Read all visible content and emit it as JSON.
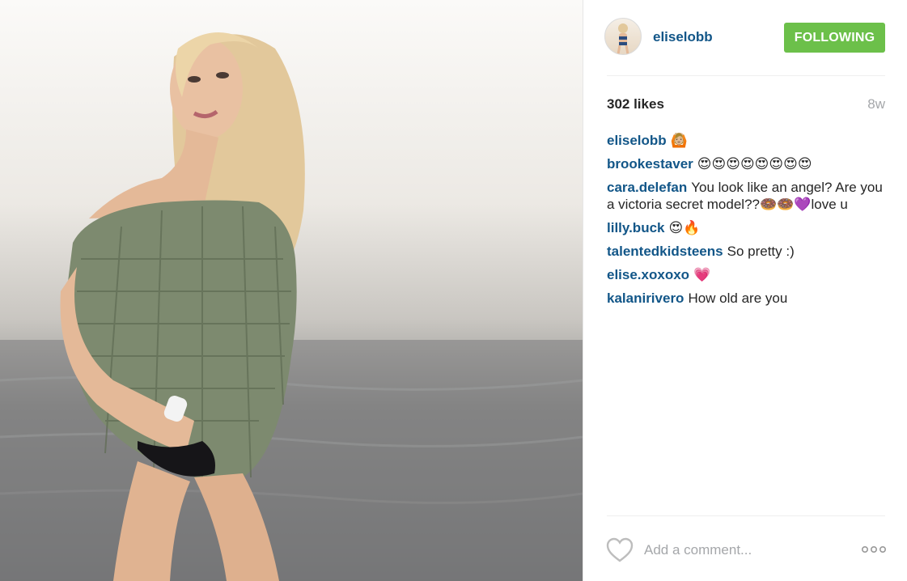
{
  "post": {
    "username": "eliselobb",
    "follow_label": "FOLLOWING",
    "likes": "302 likes",
    "time": "8w"
  },
  "comments": [
    {
      "user": "eliselobb",
      "text": "🙆🏼"
    },
    {
      "user": "brookestaver",
      "text": "😍😍😍😍😍😍😍😍"
    },
    {
      "user": "cara.delefan",
      "text": "You look like an angel? Are you a victoria secret model??🍩🍩💜love u"
    },
    {
      "user": "lilly.buck",
      "text": "😍🔥"
    },
    {
      "user": "talentedkidsteens",
      "text": "So pretty :)"
    },
    {
      "user": "elise.xoxoxo",
      "text": "💗"
    },
    {
      "user": "kalanirivero",
      "text": "How old are you"
    }
  ],
  "add_comment": {
    "placeholder": "Add a comment..."
  },
  "colors": {
    "link": "#125688",
    "follow_button": "#6cc04a",
    "muted": "#a5a7aa"
  },
  "icons": {
    "like": "heart-outline-icon",
    "options": "more-horizontal-icon"
  }
}
